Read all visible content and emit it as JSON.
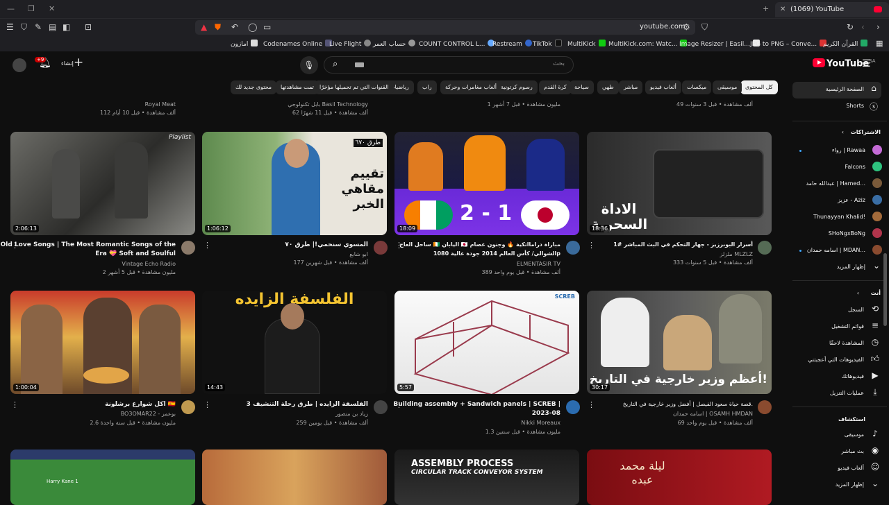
{
  "browser": {
    "tab_title": "(1069) YouTube",
    "url": "youtube.com"
  },
  "bookmarks": [
    "امازون",
    "Codenames Online",
    "Live Flight",
    "حساب العمر",
    "COUNT CONTROL L...",
    "Restream",
    "TikTok",
    "MultiKick",
    "MultiKick.com: Watc...",
    "Image Resizer | Easil...",
    "JPG to PNG – Conve...",
    "القرآن الكريم"
  ],
  "header": {
    "search_placeholder": "بحث",
    "create_label": "إنشاء",
    "notif_count": "+9",
    "logo": "YouTube",
    "region": "SA"
  },
  "chips": [
    "كل المحتوى",
    "موسيقى",
    "ميكسات",
    "ألعاب فيديو",
    "مباشر",
    "طهي",
    "سياحة",
    "كرة القدم",
    "رسوم كرتونية",
    "ألعاب مغامرات وحركة",
    "راب",
    "رياضيات",
    "القنوات التي تم تحميلها مؤخرًا",
    "تمت مشاهدتها",
    "محتوى جديد لك"
  ],
  "row0": [
    {
      "channel": "Royal Meat",
      "stats": "112 ألف مشاهدة • قبل 10 أيام"
    },
    {
      "channel": "بابل تكنولوجي Basil Technology",
      "stats": "62 ألف مشاهدة • قبل 11 شهرًا"
    },
    {
      "channel": "",
      "stats": "1 مليون مشاهدة • قبل 7 أشهر"
    },
    {
      "channel": "",
      "stats": "49 ألف مشاهدة • قبل 3 سنوات"
    }
  ],
  "videos": [
    {
      "title1": "Old Love Songs | The Most Romantic Songs of the",
      "title2": "Era 💝 Soft and Soulful",
      "channel": "Vintage Echo Radio",
      "stats": "2 مليون مشاهدة • قبل 5 أشهر",
      "duration": "2:06:13",
      "badge": "Playlist"
    },
    {
      "title1": "المسوي سنحمي!| طرق ٧٠",
      "title2": "",
      "channel": "ابو شابع",
      "stats": "177 ألف مشاهدة • قبل شهرين",
      "duration": "1:06:12",
      "overlay": "تقييم مقاهي الخبر",
      "overlay_top": "طرق ٦٧٠"
    },
    {
      "title1": "ساحل العاج 🇨🇮 اليابان 🇯🇵 مباراة درامااتكية 🔥 وجنون عصام",
      "title2": "الشوالي/ كأس العالم 2014 جودة عالية 1080p",
      "channel": "ELMENTASIR TV",
      "stats": "389 ألف مشاهدة • قبل يوم واحد",
      "duration": "18:09",
      "score": "2 - 1"
    },
    {
      "title1": "أسرار البوبرزيز - جهاز التحكم في البث المباشر #1",
      "title2": "",
      "channel": "ملزلز MLZLZ",
      "stats": "333 ألف مشاهدة • قبل 5 سنوات",
      "duration": "18:36",
      "overlay": "الاداة السحرية"
    },
    {
      "title1": "اكل شوارع برشلونة 🇪🇸",
      "title2": "",
      "channel": "BO3OMAR22 - بوعمر",
      "stats": "2.6 مليون مشاهدة • قبل سنة واحدة",
      "duration": "1:00:04"
    },
    {
      "title1": "الفلسفة الزايده | طرق رحلة التنشيف 3",
      "title2": "",
      "channel": "زياد بن منصور",
      "stats": "259 ألف مشاهدة • قبل يومين",
      "duration": "14:43",
      "overlay": "الفلسفة الزايده"
    },
    {
      "title1": "Building assembly + Sandwich panels | SCREB |",
      "title2": "2023-08",
      "channel": "Nikki Moreaux",
      "stats": "1.3 مليون مشاهدة • قبل سنتين",
      "duration": "5:57",
      "badge": "SCREB"
    },
    {
      "title1": "قصة حياة سعود الفيصل | أفضل وزير خارجية في التاريخ.",
      "title2": "",
      "channel": "اسامه حمدان | OSAMH HMDAN",
      "stats": "69 ألف مشاهدة • قبل يوم واحد",
      "duration": "30:17",
      "overlay": "أعظم وزير خارجية في التاريخ!"
    }
  ],
  "row3": {
    "t1": "ASSEMBLY PROCESS",
    "t2": "CIRCULAR TRACK CONVEYOR SYSTEM",
    "t3": "ليلة محمد عبده",
    "player": "Harry Kane 1"
  },
  "sidebar": {
    "home": "الصفحة الرئيسية",
    "shorts": "Shorts",
    "subs_header": "الاشتراكات",
    "subs": [
      {
        "name": "رواء | Rawaa",
        "dot": true,
        "color": "#c46bd6"
      },
      {
        "name": "Falcons",
        "dot": false,
        "color": "#2ec27e"
      },
      {
        "name": "عبدالله حامد | Hamed...",
        "dot": false,
        "color": "#7a5a3a"
      },
      {
        "name": "عزيز - Aziz",
        "dot": false,
        "color": "#3a6ea5"
      },
      {
        "name": "Thunayyan Khalid!",
        "dot": false,
        "color": "#a36b3b"
      },
      {
        "name": "SHoNgxBoNg",
        "dot": false,
        "color": "#b0344b"
      },
      {
        "name": "اسامه حمدان | MDAN...",
        "dot": true,
        "color": "#8a4b2f"
      }
    ],
    "show_more": "إظهار المزيد",
    "you_header": "أنت",
    "you": [
      "السجل",
      "قوائم التشغيل",
      "المشاهدة لاحقًا",
      "الفيديوهات التي أعجبتني",
      "فيديوهاتك",
      "عمليات التنزيل"
    ],
    "explore_header": "استكشاف",
    "explore": [
      "موسيقى",
      "بث مباشر",
      "ألعاب فيديو",
      "إظهار المزيد"
    ]
  }
}
